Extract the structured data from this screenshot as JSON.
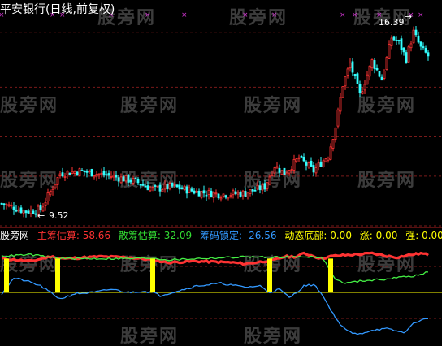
{
  "header": {
    "title": "平安银行(日线,前复权)"
  },
  "watermark": "股旁网",
  "legend": {
    "prefix": "股旁网",
    "items": [
      {
        "label": "主筹估算:",
        "value": "58.66",
        "color": "#ff3333"
      },
      {
        "label": "散筹估算:",
        "value": "32.09",
        "color": "#33dd33"
      },
      {
        "label": "筹码锁定:",
        "value": "-26.56",
        "color": "#3399ff"
      },
      {
        "label": "动态底部:",
        "value": "0.00",
        "color": "#ffff00"
      },
      {
        "label": "涨:",
        "value": "0.00",
        "color": "#ffff00"
      },
      {
        "label": "强:",
        "value": "0.00",
        "color": "#ffff00"
      }
    ]
  },
  "chart_data": [
    {
      "type": "candlestick",
      "annotations": {
        "high": "16.39",
        "low": "9.52"
      },
      "ylim": [
        9.0,
        17.2
      ],
      "up_color": "#ff3333",
      "down_color": "#33ffff",
      "marker_color": "#cc33cc",
      "grid": "dashed-red",
      "close_anchors": [
        [
          0,
          9.85
        ],
        [
          10,
          9.55
        ],
        [
          16,
          9.62
        ],
        [
          20,
          10.3
        ],
        [
          24,
          11.0
        ],
        [
          32,
          11.1
        ],
        [
          45,
          10.9
        ],
        [
          55,
          10.7
        ],
        [
          62,
          10.4
        ],
        [
          70,
          10.5
        ],
        [
          80,
          10.3
        ],
        [
          90,
          10.2
        ],
        [
          100,
          10.25
        ],
        [
          108,
          10.5
        ],
        [
          112,
          11.3
        ],
        [
          116,
          11.0
        ],
        [
          122,
          11.6
        ],
        [
          128,
          11.1
        ],
        [
          134,
          11.7
        ],
        [
          137,
          12.8
        ],
        [
          140,
          14.4
        ],
        [
          143,
          15.2
        ],
        [
          147,
          14.0
        ],
        [
          152,
          15.3
        ],
        [
          156,
          14.6
        ],
        [
          160,
          16.2
        ],
        [
          163,
          16.0
        ],
        [
          166,
          15.4
        ],
        [
          169,
          16.4
        ],
        [
          172,
          15.8
        ],
        [
          175,
          15.5
        ]
      ],
      "top_markers": [
        0,
        21,
        25,
        45,
        60,
        75,
        100,
        112,
        140,
        145,
        155,
        168,
        172
      ]
    },
    {
      "type": "line",
      "ylim": [
        -80,
        80
      ],
      "series": [
        {
          "name": "主筹估算",
          "color": "#ff3333",
          "width": 3.2,
          "anchors": [
            [
              0,
              52
            ],
            [
              12,
              48
            ],
            [
              20,
              55
            ],
            [
              26,
              52
            ],
            [
              40,
              55
            ],
            [
              52,
              54
            ],
            [
              62,
              50
            ],
            [
              68,
              46
            ],
            [
              80,
              48
            ],
            [
              95,
              46
            ],
            [
              100,
              44
            ],
            [
              108,
              48
            ],
            [
              112,
              50
            ],
            [
              116,
              55
            ],
            [
              121,
              55
            ],
            [
              124,
              60
            ],
            [
              128,
              56
            ],
            [
              131,
              52
            ],
            [
              136,
              56
            ],
            [
              144,
              58
            ],
            [
              152,
              60
            ],
            [
              158,
              56
            ],
            [
              162,
              54
            ],
            [
              168,
              58
            ],
            [
              172,
              60
            ],
            [
              175,
              58
            ]
          ]
        },
        {
          "name": "散筹估算",
          "color": "#44ee44",
          "width": 1.3,
          "anchors": [
            [
              0,
              56
            ],
            [
              12,
              58
            ],
            [
              20,
              54
            ],
            [
              26,
              52
            ],
            [
              40,
              52
            ],
            [
              52,
              52
            ],
            [
              62,
              53
            ],
            [
              68,
              50
            ],
            [
              80,
              52
            ],
            [
              95,
              54
            ],
            [
              100,
              55
            ],
            [
              108,
              54
            ],
            [
              112,
              54
            ],
            [
              116,
              55
            ],
            [
              121,
              54
            ],
            [
              124,
              55
            ],
            [
              128,
              55
            ],
            [
              131,
              54
            ],
            [
              134,
              40
            ],
            [
              137,
              20
            ],
            [
              141,
              14
            ],
            [
              148,
              18
            ],
            [
              156,
              20
            ],
            [
              165,
              24
            ],
            [
              171,
              26
            ],
            [
              175,
              32
            ]
          ]
        },
        {
          "name": "筹码锁定",
          "color": "#3399ff",
          "width": 1.3,
          "anchors": [
            [
              0,
              -2
            ],
            [
              5,
              22
            ],
            [
              10,
              18
            ],
            [
              16,
              10
            ],
            [
              20,
              0
            ],
            [
              24,
              -10
            ],
            [
              30,
              -2
            ],
            [
              38,
              0
            ],
            [
              45,
              5
            ],
            [
              52,
              0
            ],
            [
              58,
              2
            ],
            [
              62,
              0
            ],
            [
              65,
              -5
            ],
            [
              70,
              0
            ],
            [
              80,
              10
            ],
            [
              90,
              14
            ],
            [
              100,
              8
            ],
            [
              106,
              10
            ],
            [
              110,
              0
            ],
            [
              114,
              5
            ],
            [
              118,
              -8
            ],
            [
              121,
              0
            ],
            [
              124,
              10
            ],
            [
              128,
              12
            ],
            [
              131,
              0
            ],
            [
              134,
              -20
            ],
            [
              138,
              -45
            ],
            [
              142,
              -60
            ],
            [
              146,
              -65
            ],
            [
              152,
              -58
            ],
            [
              158,
              -56
            ],
            [
              165,
              -62
            ],
            [
              170,
              -45
            ],
            [
              175,
              -40
            ]
          ]
        }
      ],
      "zero_line_color": "#ffff00",
      "bar_color": "#ffff00",
      "signal_bars": [
        2,
        23,
        62,
        110,
        135
      ]
    }
  ]
}
